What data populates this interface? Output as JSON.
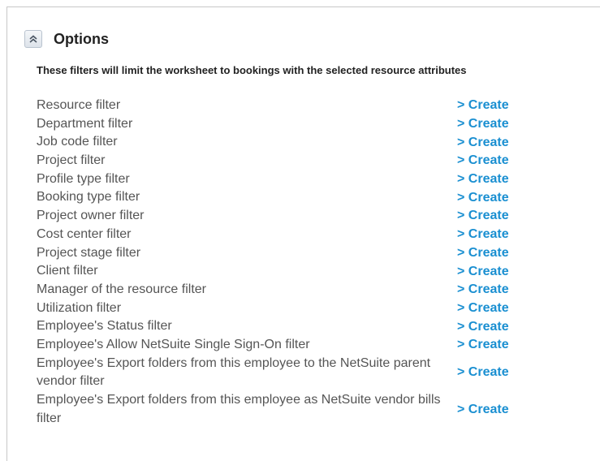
{
  "options": {
    "title": "Options",
    "collapse_icon": "double-chevron-up-icon",
    "subtitle": "These filters will limit the worksheet to bookings with the selected resource attributes",
    "create_label": "> Create",
    "link_color": "#1a8fd1",
    "filters": [
      {
        "label": "Resource filter"
      },
      {
        "label": "Department filter"
      },
      {
        "label": "Job code filter"
      },
      {
        "label": "Project filter"
      },
      {
        "label": "Profile type filter"
      },
      {
        "label": "Booking type filter"
      },
      {
        "label": "Project owner filter"
      },
      {
        "label": "Cost center filter"
      },
      {
        "label": "Project stage filter"
      },
      {
        "label": "Client filter"
      },
      {
        "label": "Manager of the resource filter"
      },
      {
        "label": "Utilization filter"
      },
      {
        "label": "Employee's Status filter"
      },
      {
        "label": "Employee's Allow NetSuite Single Sign-On filter"
      },
      {
        "label": "Employee's Export folders from this employee to the NetSuite parent vendor filter"
      },
      {
        "label": "Employee's Export folders from this employee as NetSuite vendor bills filter"
      }
    ]
  }
}
